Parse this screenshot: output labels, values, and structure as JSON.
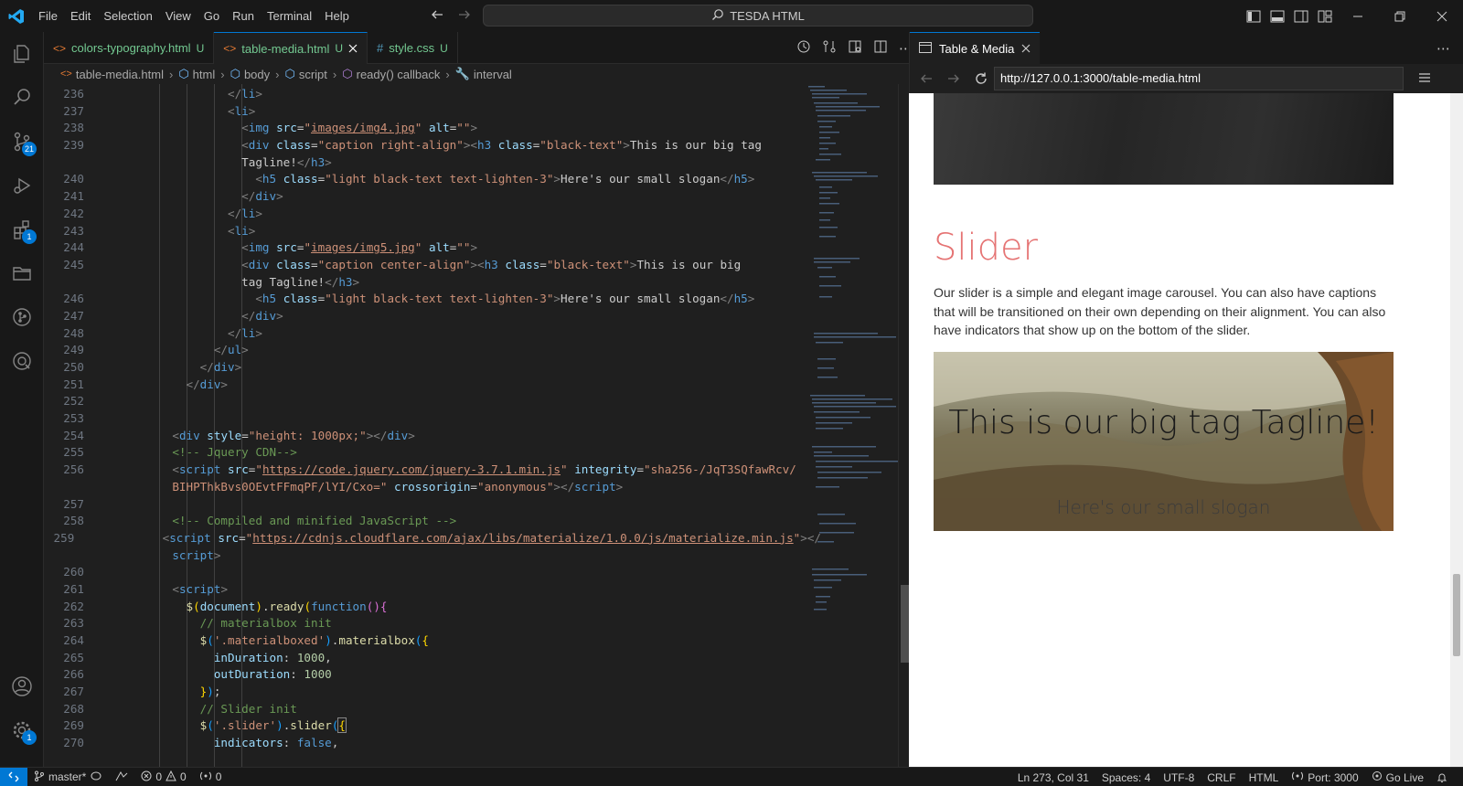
{
  "titlebar": {
    "menu": [
      "File",
      "Edit",
      "Selection",
      "View",
      "Go",
      "Run",
      "Terminal",
      "Help"
    ],
    "search_text": "TESDA HTML"
  },
  "activity": {
    "source_control_badge": "21",
    "extensions_badge": "1",
    "settings_badge": "1"
  },
  "tabs": [
    {
      "label": "colors-typography.html",
      "status": "U"
    },
    {
      "label": "table-media.html",
      "status": "U"
    },
    {
      "label": "style.css",
      "status": "U"
    }
  ],
  "breadcrumb": [
    "table-media.html",
    "html",
    "body",
    "script",
    "ready() callback",
    "interval"
  ],
  "code": {
    "lines": {
      "236": "236",
      "237": "237",
      "238": "238",
      "239": "239",
      "240": "240",
      "241": "241",
      "242": "242",
      "243": "243",
      "244": "244",
      "245": "245",
      "246": "246",
      "247": "247",
      "248": "248",
      "249": "249",
      "250": "250",
      "251": "251",
      "252": "252",
      "253": "253",
      "254": "254",
      "255": "255",
      "256": "256",
      "257": "257",
      "258": "258",
      "259": "259",
      "260": "260",
      "261": "261",
      "262": "262",
      "263": "263",
      "264": "264",
      "265": "265",
      "266": "266",
      "267": "267",
      "268": "268",
      "269": "269",
      "270": "270"
    },
    "img4_src": "images/img4.jpg",
    "img5_src": "images/img5.jpg",
    "tagline": "This is our big tag",
    "tagline_end": "Tagline!",
    "tagline_wrap": "tag Tagline!",
    "tagline_short": "This is our big",
    "slogan": "Here's our small slogan",
    "jquery_src": "https://code.jquery.com/jquery-3.7.1.min.js",
    "jquery_integrity_1": "sha256-/JqT3SQfawRcv/",
    "jquery_integrity_2": "BIHPThkBvs0OEvtFFmqPF/lYI/Cxo=",
    "comment_jquery": "<!-- Jquery CDN-->",
    "comment_compiled": "<!-- Compiled and minified JavaScript -->",
    "materialize_src": "https://cdnjs.cloudflare.com/ajax/libs/materialize/1.0.0/js/materialize.min.js",
    "comment_materialbox": "// materialbox init",
    "comment_slider": "// Slider init",
    "in_duration": "1000",
    "out_duration": "1000"
  },
  "preview": {
    "tab_label": "Table & Media",
    "url": "http://127.0.0.1:3000/table-media.html",
    "heading": "Slider",
    "paragraph": "Our slider is a simple and elegant image carousel. You can also have captions that will be transitioned on their own depending on their alignment. You can also have indicators that show up on the bottom of the slider.",
    "caption_title": "This is our big tag Tagline!",
    "caption_sub": "Here's our small slogan"
  },
  "statusbar": {
    "branch": "master*",
    "errors": "0",
    "warnings": "0",
    "ports": "0",
    "position": "Ln 273, Col 31",
    "spaces": "Spaces: 4",
    "encoding": "UTF-8",
    "eol": "CRLF",
    "language": "HTML",
    "port": "Port: 3000",
    "golive": "Go Live"
  },
  "colors": {
    "accent": "#0078d4",
    "heading_red": "#e57373",
    "untracked_green": "#73c991"
  }
}
